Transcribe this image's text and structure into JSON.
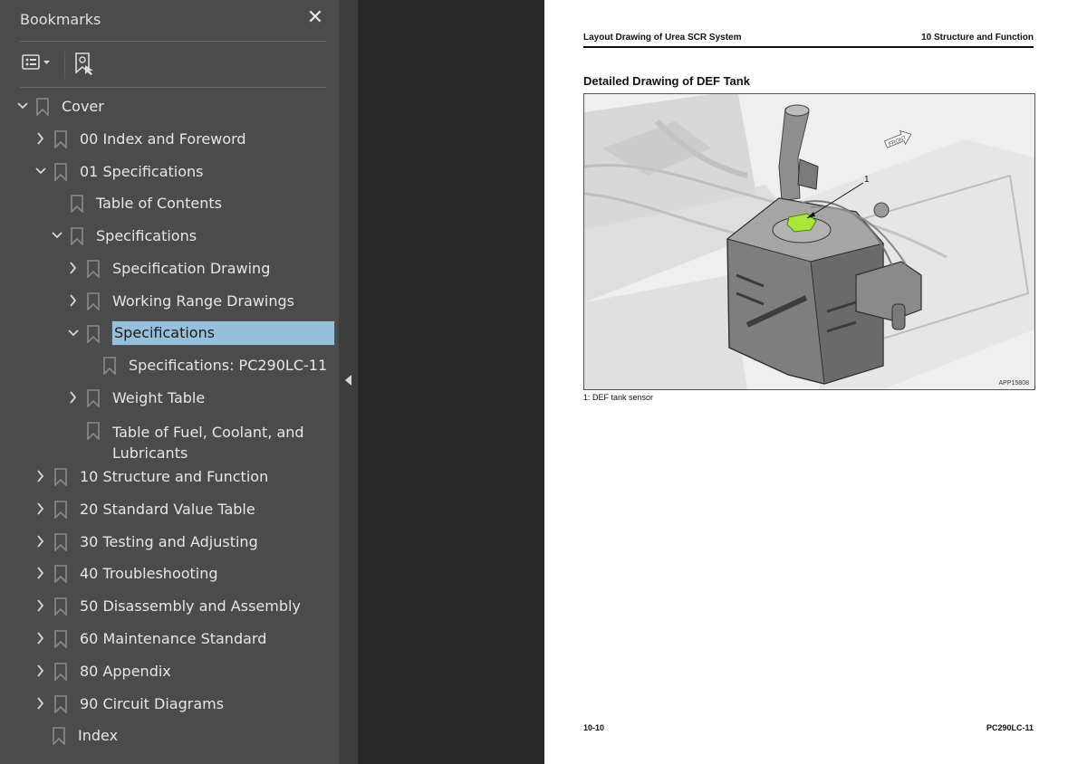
{
  "bookmarks_panel": {
    "title": "Bookmarks",
    "close_icon": "close-icon",
    "toolbar": {
      "options_icon": "list-options-icon",
      "find_icon": "find-current-bookmark-icon"
    },
    "collapse_icon": "collapse-panel-icon",
    "items": [
      {
        "label": "Cover",
        "level": 0,
        "state": "expanded"
      },
      {
        "label": "00 Index and Foreword",
        "level": 1,
        "state": "collapsed"
      },
      {
        "label": "01 Specifications",
        "level": 1,
        "state": "expanded"
      },
      {
        "label": "Table of Contents",
        "level": 2,
        "state": "leaf"
      },
      {
        "label": "Specifications",
        "level": 2,
        "state": "expanded"
      },
      {
        "label": "Specification Drawing",
        "level": 3,
        "state": "collapsed"
      },
      {
        "label": "Working Range Drawings",
        "level": 3,
        "state": "collapsed"
      },
      {
        "label": "Specifications",
        "level": 3,
        "state": "expanded",
        "selected": true
      },
      {
        "label": "Specifications: PC290LC-11",
        "level": 4,
        "state": "leaf"
      },
      {
        "label": "Weight Table",
        "level": 3,
        "state": "collapsed"
      },
      {
        "label": "Table of Fuel, Coolant, and Lubricants",
        "level": 3,
        "state": "leaf"
      },
      {
        "label": "10 Structure and Function",
        "level": 1,
        "state": "collapsed"
      },
      {
        "label": "20 Standard Value Table",
        "level": 1,
        "state": "collapsed"
      },
      {
        "label": "30 Testing and Adjusting",
        "level": 1,
        "state": "collapsed"
      },
      {
        "label": "40 Troubleshooting",
        "level": 1,
        "state": "collapsed"
      },
      {
        "label": "50 Disassembly and Assembly",
        "level": 1,
        "state": "collapsed"
      },
      {
        "label": "60 Maintenance Standard",
        "level": 1,
        "state": "collapsed"
      },
      {
        "label": "80 Appendix",
        "level": 1,
        "state": "collapsed"
      },
      {
        "label": "90 Circuit Diagrams",
        "level": 1,
        "state": "collapsed"
      },
      {
        "label": "Index",
        "level": 1,
        "state": "leaf"
      }
    ]
  },
  "document": {
    "header_left": "Layout Drawing of Urea SCR System",
    "header_right": "10 Structure and Function",
    "section_title": "Detailed Drawing of DEF Tank",
    "figure": {
      "callout": "1",
      "front_label": "FRONT",
      "figure_id": "APP15808",
      "highlight_color": "#a8e63a"
    },
    "caption": "1: DEF tank sensor",
    "footer_left": "10-10",
    "footer_right": "PC290LC-11"
  },
  "colors": {
    "panel_bg": "#4b4b4b",
    "selection_bg": "#97c0dd",
    "workspace_bg": "#282828"
  }
}
